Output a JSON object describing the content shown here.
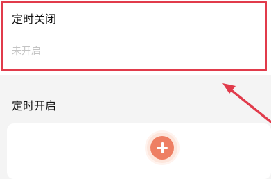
{
  "timer_off": {
    "title": "定时关闭",
    "status": "未开启"
  },
  "timer_on": {
    "title": "定时开启"
  },
  "add_button": {
    "icon": "plus-icon"
  },
  "colors": {
    "highlight": "#e13b4b",
    "accent": "#ee7f63",
    "muted_text": "#c4c4c4"
  }
}
